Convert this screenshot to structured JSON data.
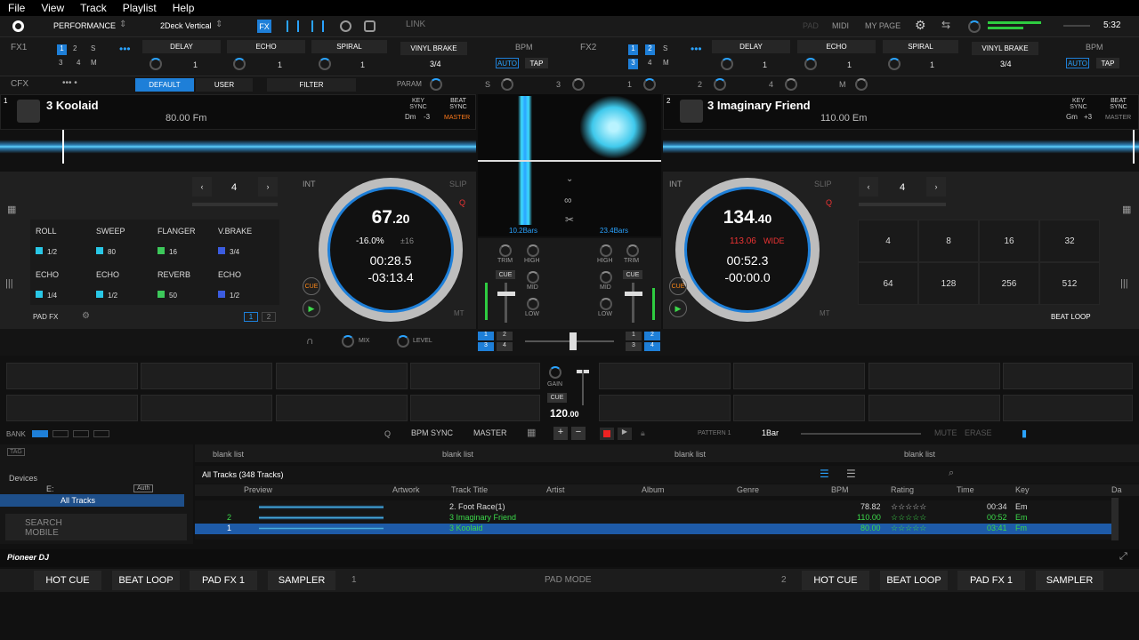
{
  "menu": [
    "File",
    "View",
    "Track",
    "Playlist",
    "Help"
  ],
  "toolbar": {
    "mode": "PERFORMANCE",
    "layout": "2Deck Vertical",
    "link": "LINK",
    "pad": "PAD",
    "midi": "MIDI",
    "mypage": "MY PAGE",
    "clock": "5:32"
  },
  "fx1": {
    "label": "FX1",
    "slots": [
      "DELAY",
      "ECHO",
      "SPIRAL",
      "VINYL BRAKE"
    ],
    "bpm": "BPM",
    "auto": "AUTO",
    "tap": "TAP",
    "beat": "3/4",
    "nums": [
      "1",
      "1",
      "1"
    ]
  },
  "fx2": {
    "label": "FX2",
    "slots": [
      "DELAY",
      "ECHO",
      "SPIRAL",
      "VINYL BRAKE"
    ],
    "bpm": "BPM",
    "auto": "AUTO",
    "tap": "TAP",
    "beat": "3/4",
    "nums": [
      "1",
      "1",
      "1"
    ]
  },
  "cfx": {
    "label": "CFX",
    "default": "DEFAULT",
    "user": "USER",
    "filter": "FILTER",
    "param": "PARAM",
    "s": "S",
    "n3": "3",
    "n1": "1",
    "n2": "2",
    "n4": "4",
    "m": "M"
  },
  "deck1": {
    "num": "1",
    "title": "3 Koolaid",
    "info": "80.00 Fm",
    "key": "Dm",
    "keyshift": "-3",
    "master": "MASTER",
    "keysync": "KEY SYNC",
    "beatsync": "BEAT SYNC",
    "bpm_int": "67",
    "bpm_dec": ".20",
    "pitch": "-16.0%",
    "range": "±16",
    "elapsed": "00:28.5",
    "remain": "-03:13.4",
    "loop": "4",
    "int": "INT",
    "slip": "SLIP",
    "cue": "CUE",
    "mt": "MT",
    "q": "Q"
  },
  "deck2": {
    "num": "2",
    "title": "3 Imaginary Friend",
    "info": "110.00 Em",
    "key": "Gm",
    "keyshift": "+3",
    "master": "MASTER",
    "keysync": "KEY SYNC",
    "beatsync": "BEAT SYNC",
    "bpm_int": "134",
    "bpm_dec": ".40",
    "pitch": "113.06",
    "wide": "WIDE",
    "elapsed": "00:52.3",
    "remain": "-00:00.0",
    "loop": "4",
    "int": "INT",
    "slip": "SLIP",
    "cue": "CUE",
    "mt": "MT",
    "q": "Q"
  },
  "center": {
    "bars1": "10.2Bars",
    "bars2": "23.4Bars",
    "trim": "TRIM",
    "high": "HIGH",
    "mid": "MID",
    "low": "LOW",
    "cue": "CUE"
  },
  "padfx": {
    "items": [
      {
        "name": "ROLL",
        "val": "1/2",
        "color": "#29c7e6"
      },
      {
        "name": "SWEEP",
        "val": "80",
        "color": "#29c7e6"
      },
      {
        "name": "FLANGER",
        "val": "16",
        "color": "#3cc85a"
      },
      {
        "name": "V.BRAKE",
        "val": "3/4",
        "color": "#3b5ce0"
      },
      {
        "name": "ECHO",
        "val": "1/4",
        "color": "#29c7e6"
      },
      {
        "name": "ECHO",
        "val": "1/2",
        "color": "#29c7e6"
      },
      {
        "name": "REVERB",
        "val": "50",
        "color": "#3cc85a"
      },
      {
        "name": "ECHO",
        "val": "1/2",
        "color": "#3b5ce0"
      }
    ],
    "label": "PAD FX",
    "p1": "1",
    "p2": "2"
  },
  "beatloop": {
    "values": [
      "4",
      "8",
      "16",
      "32",
      "64",
      "128",
      "256",
      "512"
    ],
    "label": "BEAT LOOP"
  },
  "headphone": {
    "mix": "MIX",
    "level": "LEVEL",
    "nums": [
      "1",
      "2",
      "3",
      "4"
    ]
  },
  "sampler": {
    "gain": "GAIN",
    "cue": "CUE",
    "bpm": "120",
    "bpm_dec": ".00",
    "bank": "BANK",
    "q": "Q",
    "bpmsync": "BPM SYNC",
    "master": "MASTER",
    "pattern": "PATTERN 1",
    "bar": "1Bar",
    "mute": "MUTE",
    "erase": "ERASE"
  },
  "browser": {
    "tag": "TAG",
    "devices": "Devices",
    "drive": "E:",
    "auth": "Auth",
    "alltracks": "All Tracks",
    "search": "SEARCH MOBILE",
    "lists": [
      "blank list",
      "blank list",
      "blank list",
      "blank list"
    ],
    "header": "All Tracks (348 Tracks)",
    "columns": [
      "Preview",
      "Artwork",
      "Track Title",
      "Artist",
      "Album",
      "Genre",
      "BPM",
      "Rating",
      "Time",
      "Key",
      "Da"
    ],
    "rows": [
      {
        "deck": "",
        "title": "2.  Foot Race(1)",
        "bpm": "78.82",
        "time": "00:34",
        "key": "Em",
        "color": "#ddd"
      },
      {
        "deck": "2",
        "title": "3 Imaginary Friend",
        "bpm": "110.00",
        "time": "00:52",
        "key": "Em",
        "color": "#3cd84a"
      },
      {
        "deck": "1",
        "title": "3 Koolaid",
        "bpm": "80.00",
        "time": "03:41",
        "key": "Fm",
        "color": "#3cd84a"
      }
    ]
  },
  "bottom": {
    "brand": "Pioneer DJ",
    "left": [
      "HOT CUE",
      "BEAT LOOP",
      "PAD FX 1",
      "SAMPLER"
    ],
    "right": [
      "HOT CUE",
      "BEAT LOOP",
      "PAD FX 1",
      "SAMPLER"
    ],
    "n1": "1",
    "padmode": "PAD MODE",
    "n2": "2"
  }
}
